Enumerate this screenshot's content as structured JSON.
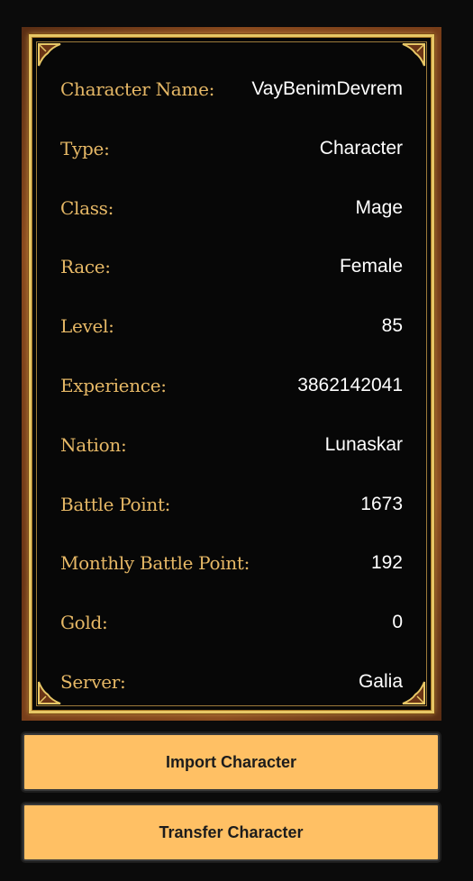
{
  "character": {
    "rows": [
      {
        "label": "Character Name:",
        "value": "VayBenimDevrem"
      },
      {
        "label": "Type:",
        "value": "Character"
      },
      {
        "label": "Class:",
        "value": "Mage"
      },
      {
        "label": "Race:",
        "value": "Female"
      },
      {
        "label": "Level:",
        "value": "85"
      },
      {
        "label": "Experience:",
        "value": "3862142041"
      },
      {
        "label": "Nation:",
        "value": "Lunaskar"
      },
      {
        "label": "Battle Point:",
        "value": "1673"
      },
      {
        "label": "Monthly Battle Point:",
        "value": "192"
      },
      {
        "label": "Gold:",
        "value": "0"
      },
      {
        "label": "Server:",
        "value": "Galia"
      }
    ]
  },
  "actions": {
    "import_label": "Import Character",
    "transfer_label": "Transfer Character"
  },
  "colors": {
    "label": "#e6b866",
    "value": "#ffffff",
    "button_bg": "#ffc064",
    "frame_gold": "#e7c766",
    "background": "#0b0b0b"
  }
}
